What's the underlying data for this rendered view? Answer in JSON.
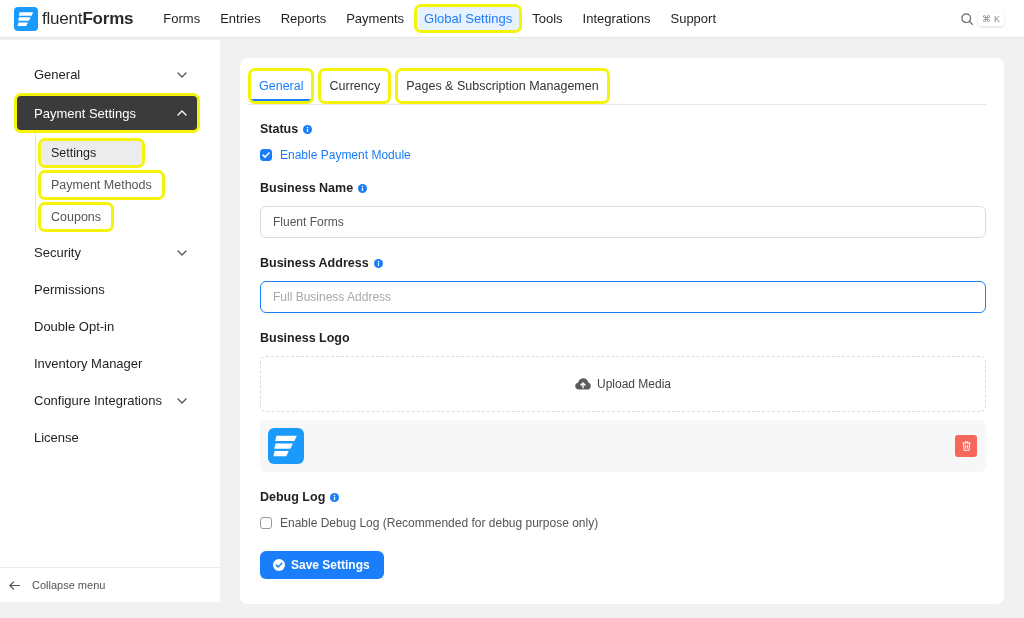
{
  "top_nav": {
    "logo": "fluent**Forms**",
    "items": [
      {
        "label": "Forms",
        "selected": false,
        "highlighted": false
      },
      {
        "label": "Entries",
        "selected": false,
        "highlighted": false
      },
      {
        "label": "Reports",
        "selected": false,
        "highlighted": false
      },
      {
        "label": "Payments",
        "selected": false,
        "highlighted": false
      },
      {
        "label": "Global Settings",
        "selected": true,
        "highlighted": true
      },
      {
        "label": "Tools",
        "selected": false,
        "highlighted": false
      },
      {
        "label": "Integrations",
        "selected": false,
        "highlighted": false
      },
      {
        "label": "Support",
        "selected": false,
        "highlighted": false
      }
    ],
    "search_shortcut": "⌘ K"
  },
  "sidebar": {
    "items": [
      {
        "label": "General",
        "kind": "group",
        "expanded": false,
        "selected": false,
        "highlighted": false
      },
      {
        "label": "Payment Settings",
        "kind": "group",
        "expanded": true,
        "selected": true,
        "highlighted": true,
        "children": [
          {
            "label": "Settings",
            "selected": true,
            "highlighted": true
          },
          {
            "label": "Payment Methods",
            "selected": false,
            "highlighted": true
          },
          {
            "label": "Coupons",
            "selected": false,
            "highlighted": true
          }
        ]
      },
      {
        "label": "Security",
        "kind": "group",
        "expanded": false,
        "selected": false,
        "highlighted": false
      },
      {
        "label": "Permissions",
        "kind": "link",
        "selected": false,
        "highlighted": false
      },
      {
        "label": "Double Opt-in",
        "kind": "link",
        "selected": false,
        "highlighted": false
      },
      {
        "label": "Inventory Manager",
        "kind": "link",
        "selected": false,
        "highlighted": false
      },
      {
        "label": "Configure Integrations",
        "kind": "group",
        "expanded": false,
        "selected": false,
        "highlighted": false
      },
      {
        "label": "License",
        "kind": "link",
        "selected": false,
        "highlighted": false
      }
    ],
    "collapse_label": "Collapse menu"
  },
  "settings_panel": {
    "tabs": [
      {
        "label": "General",
        "selected": true,
        "highlighted": true
      },
      {
        "label": "Currency",
        "selected": false,
        "highlighted": true
      },
      {
        "label": "Pages & Subscription Managemen",
        "selected": false,
        "highlighted": true
      }
    ],
    "fields": [
      {
        "kind": "checkbox",
        "label": "Status",
        "info": true,
        "option": "Enable Payment Module",
        "checked": true
      },
      {
        "kind": "text",
        "label": "Business Name",
        "info": true,
        "value": "Fluent Forms",
        "focused": false
      },
      {
        "kind": "text",
        "label": "Business Address",
        "info": true,
        "placeholder": "Full Business Address",
        "focused": true
      },
      {
        "kind": "upload",
        "label": "Business Logo",
        "info": false,
        "button": "Upload Media",
        "uploaded": true
      },
      {
        "kind": "checkbox",
        "label": "Debug Log",
        "info": true,
        "option": "Enable Debug Log (Recommended for debug purpose only)",
        "checked": false
      }
    ],
    "save_button": "Save Settings"
  }
}
